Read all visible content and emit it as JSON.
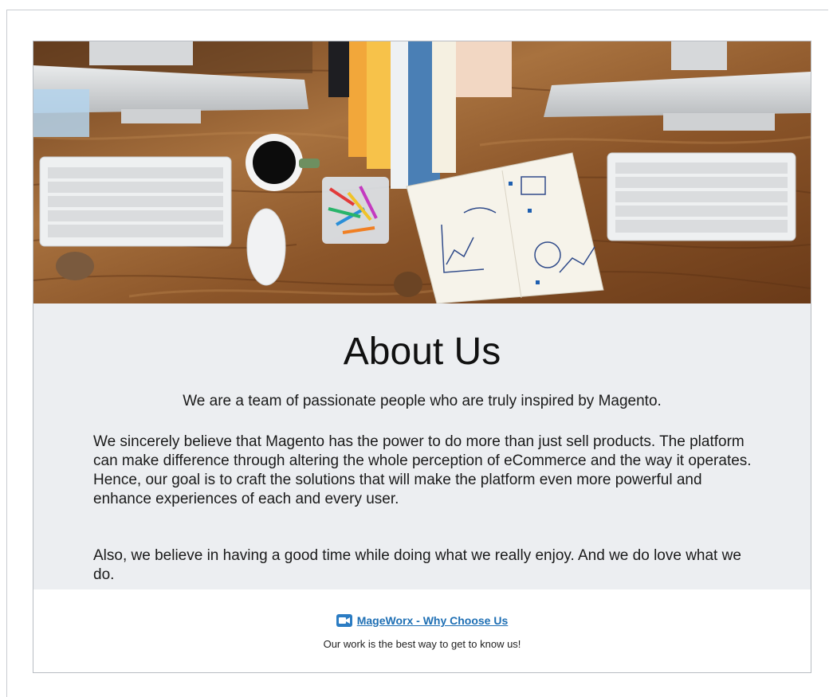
{
  "about": {
    "title": "About Us",
    "lead": "We are a team of passionate people who are truly inspired by Magento.",
    "paragraphs": [
      "We sincerely believe that Magento has the power to do more than just sell products. The platform can make difference through altering the whole perception of eCommerce and the way it operates. Hence, our goal is to craft the solutions that will make the platform even more powerful and enhance experiences of each and every user.",
      "Also, we believe in having a good time while doing what we really enjoy. And we do love what we do."
    ]
  },
  "footer": {
    "video_link_label": "MageWorx - Why Choose Us",
    "video_icon": "video-camera-icon",
    "tagline": "Our work is the best way to get to know us!"
  },
  "hero": {
    "image_subject": "desk with computers, keyboards, coffee cup, paper clips, notebook with charts"
  },
  "colors": {
    "panel_background": "#eceef1",
    "link": "#1e6fb4",
    "icon_accent": "#2b7cc3"
  }
}
